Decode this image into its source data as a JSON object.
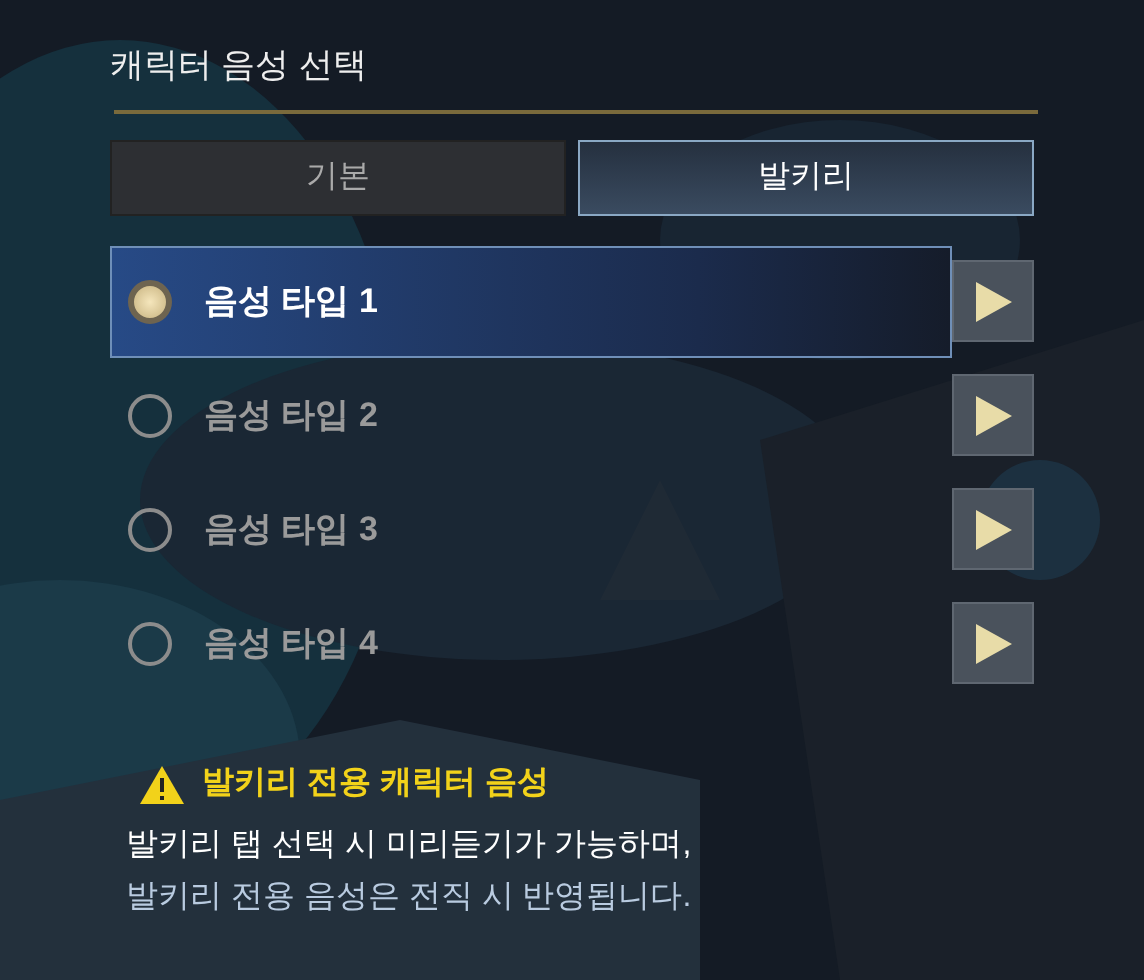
{
  "title": "캐릭터 음성 선택",
  "tabs": [
    {
      "label": "기본",
      "selected": false
    },
    {
      "label": "발키리",
      "selected": true
    }
  ],
  "voices": [
    {
      "label": "음성 타입 1",
      "selected": true
    },
    {
      "label": "음성 타입 2",
      "selected": false
    },
    {
      "label": "음성 타입 3",
      "selected": false
    },
    {
      "label": "음성 타입 4",
      "selected": false
    }
  ],
  "notice": {
    "heading": "발키리 전용 캐릭터 음성",
    "lines": [
      "발키리 탭 선택 시 미리듣기가 가능하며,",
      "발키리 전용 음성은 전직 시 반영됩니다."
    ]
  }
}
